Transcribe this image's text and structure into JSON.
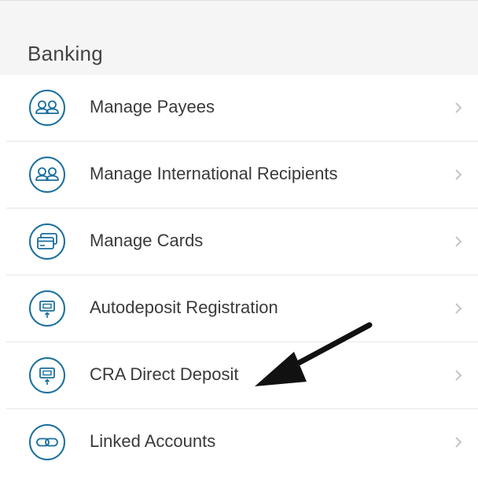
{
  "section": {
    "title": "Banking"
  },
  "colors": {
    "icon": "#1a6f9e",
    "chevron": "#c4c4c4",
    "text": "#3a3a3a",
    "header_bg": "#f5f5f5"
  },
  "items": [
    {
      "label": "Manage Payees",
      "icon": "people-icon"
    },
    {
      "label": "Manage International Recipients",
      "icon": "people-icon"
    },
    {
      "label": "Manage Cards",
      "icon": "cards-icon"
    },
    {
      "label": "Autodeposit Registration",
      "icon": "deposit-icon"
    },
    {
      "label": "CRA Direct Deposit",
      "icon": "deposit-icon"
    },
    {
      "label": "Linked Accounts",
      "icon": "link-icon"
    }
  ]
}
